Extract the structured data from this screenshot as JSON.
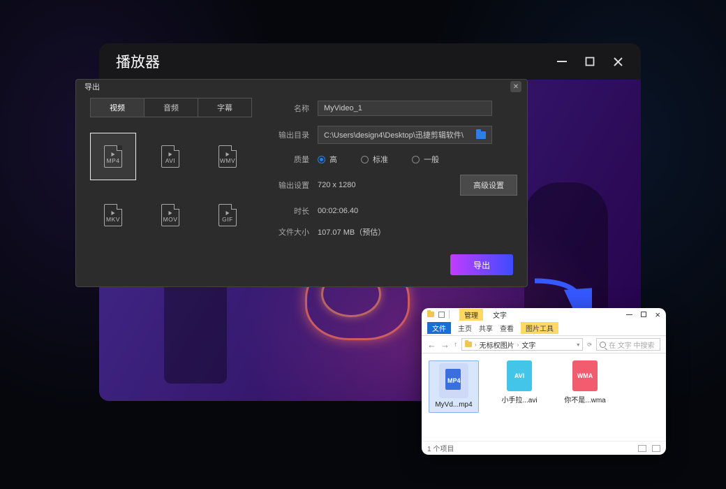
{
  "player": {
    "title": "播放器"
  },
  "export": {
    "title": "导出",
    "tabs": {
      "video": "视频",
      "audio": "音频",
      "subtitle": "字幕"
    },
    "formats": [
      "MP4",
      "AVI",
      "WMV",
      "MKV",
      "MOV",
      "GIF"
    ],
    "labels": {
      "name": "名称",
      "output_dir": "输出目录",
      "quality": "质量",
      "output_setting": "输出设置",
      "duration": "时长",
      "file_size": "文件大小",
      "advanced": "高级设置"
    },
    "name_value": "MyVideo_1",
    "path_value": "C:\\Users\\design4\\Desktop\\迅捷剪辑软件\\",
    "quality_options": {
      "high": "高",
      "standard": "标准",
      "normal": "一般"
    },
    "resolution": "720 x 1280",
    "duration_value": "00:02:06.40",
    "filesize_value": "107.07 MB（预估）",
    "export_btn": "导出"
  },
  "explorer": {
    "tabs_row1": {
      "manage": "管理",
      "title": "文字"
    },
    "tabs_row2": {
      "file": "文件",
      "home": "主页",
      "share": "共享",
      "view": "查看",
      "pictools": "图片工具"
    },
    "breadcrumb": {
      "a": "无标权图片",
      "b": "文字"
    },
    "search_placeholder": "在 文字 中搜索",
    "files": [
      {
        "type": "MP4",
        "name": "MyVd...mp4"
      },
      {
        "type": "AVI",
        "name": "小手拉...avi"
      },
      {
        "type": "WMA",
        "name": "你不是...wma"
      }
    ],
    "status": "1 个项目"
  }
}
